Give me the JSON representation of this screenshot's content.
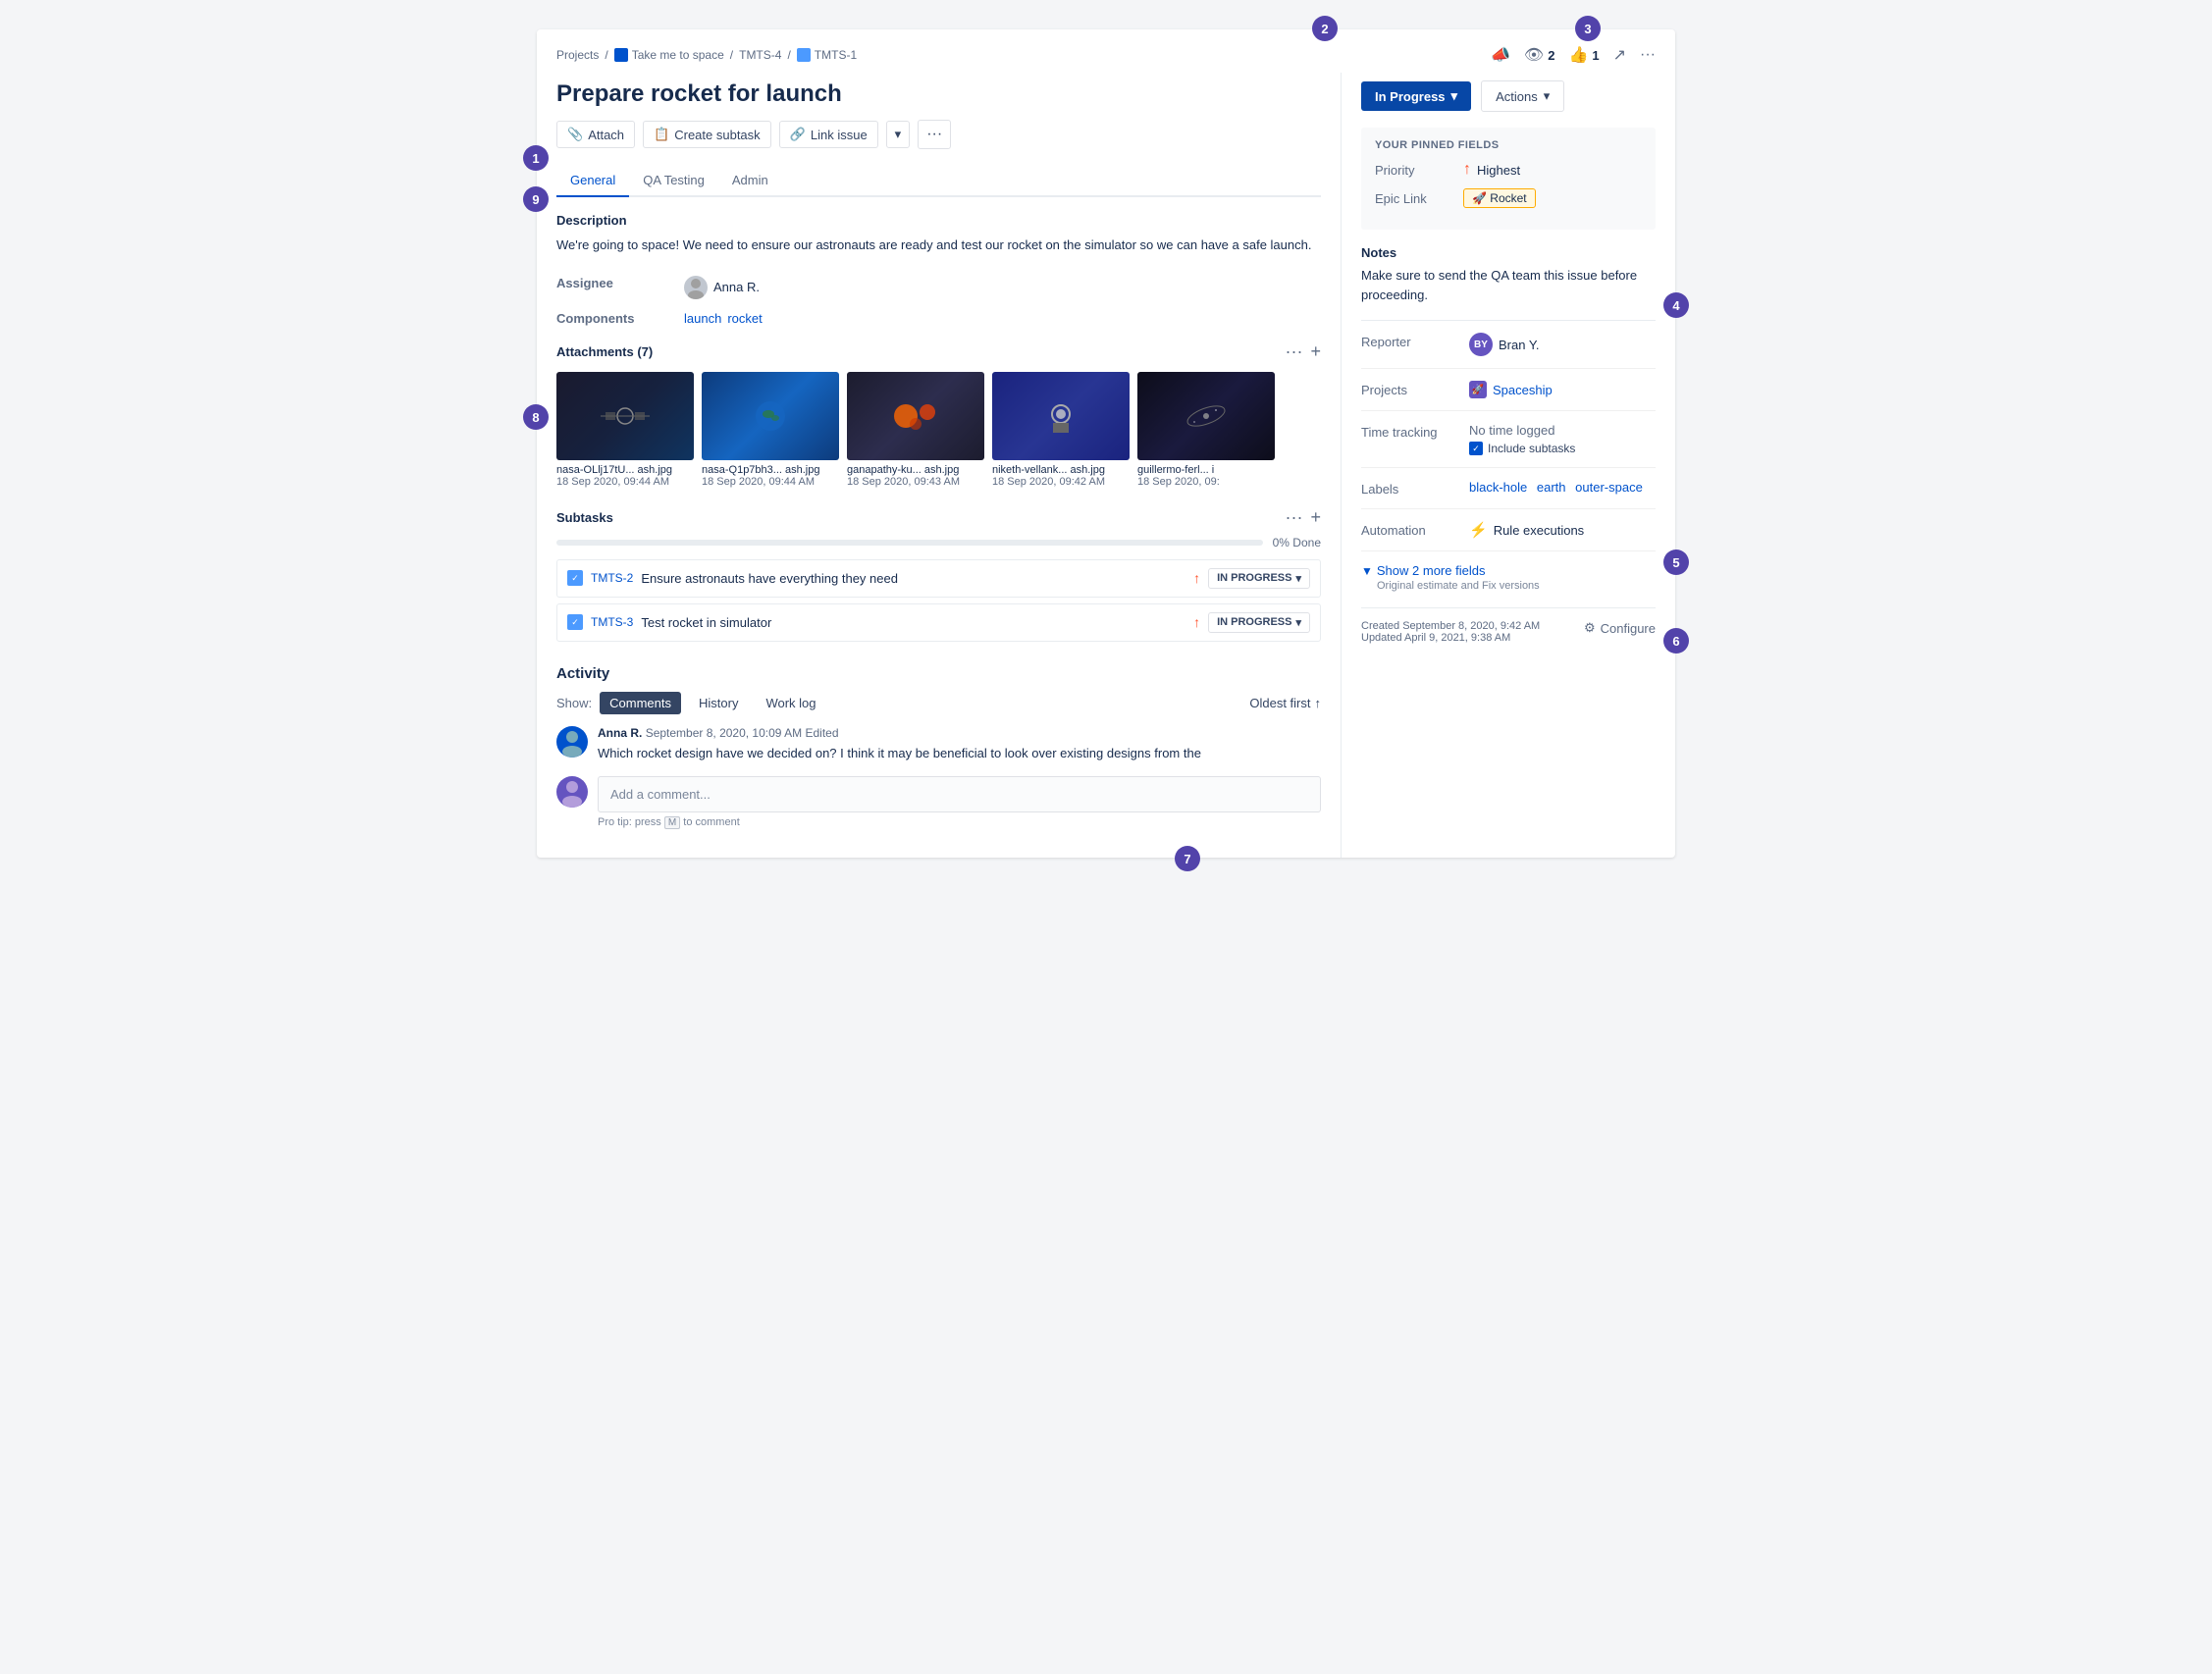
{
  "breadcrumb": {
    "projects": "Projects",
    "space": "Take me to space",
    "tmts4": "TMTS-4",
    "tmts1": "TMTS-1"
  },
  "issue": {
    "title": "Prepare rocket for launch"
  },
  "toolbar": {
    "attach": "Attach",
    "create_subtask": "Create subtask",
    "link_issue": "Link issue",
    "more": "···"
  },
  "tabs": [
    "General",
    "QA Testing",
    "Admin"
  ],
  "description": {
    "label": "Description",
    "text": "We're going to space! We need to ensure our astronauts are ready and test our rocket on the simulator so we can have a safe launch."
  },
  "fields": {
    "assignee_label": "Assignee",
    "assignee_value": "Anna R.",
    "components_label": "Components",
    "components": [
      "launch",
      "rocket"
    ]
  },
  "attachments": {
    "title": "Attachments (7)",
    "items": [
      {
        "filename": "nasa-OLlj17tU... ash.jpg",
        "date": "18 Sep 2020, 09:44 AM",
        "thumb": "space"
      },
      {
        "filename": "nasa-Q1p7bh3... ash.jpg",
        "date": "18 Sep 2020, 09:44 AM",
        "thumb": "earth"
      },
      {
        "filename": "ganapathy-ku... ash.jpg",
        "date": "18 Sep 2020, 09:43 AM",
        "thumb": "moon"
      },
      {
        "filename": "niketh-vellank... ash.jpg",
        "date": "18 Sep 2020, 09:42 AM",
        "thumb": "astro"
      },
      {
        "filename": "guillermo-ferl... i",
        "date": "18 Sep 2020, 09:",
        "thumb": "galaxy"
      }
    ]
  },
  "subtasks": {
    "title": "Subtasks",
    "progress_pct": "0% Done",
    "progress_value": 0,
    "items": [
      {
        "id": "TMTS-2",
        "text": "Ensure astronauts have everything they need",
        "status": "IN PROGRESS"
      },
      {
        "id": "TMTS-3",
        "text": "Test rocket in simulator",
        "status": "IN PROGRESS"
      }
    ]
  },
  "activity": {
    "title": "Activity",
    "show_label": "Show:",
    "tabs": [
      "Comments",
      "History",
      "Work log"
    ],
    "active_tab": "Comments",
    "sort": "Oldest first",
    "comments": [
      {
        "author": "Anna R.",
        "date": "September 8, 2020, 10:09 AM",
        "edited": "Edited",
        "text": "Which rocket design have we decided on? I think it may be beneficial to look over existing designs from the"
      }
    ],
    "add_placeholder": "Add a comment...",
    "tip": "Pro tip: press",
    "tip_key": "M",
    "tip_suffix": "to comment"
  },
  "right_panel": {
    "top_icons": {
      "announce": "📣",
      "watch_count": "2",
      "like_count": "1"
    },
    "status": "In Progress",
    "actions": "Actions",
    "pinned_label": "YOUR PINNED FIELDS",
    "priority_label": "Priority",
    "priority_value": "Highest",
    "epic_label": "Epic Link",
    "epic_value": "🚀 Rocket",
    "notes_label": "Notes",
    "notes_text": "Make sure to send the QA team this issue before proceeding.",
    "reporter_label": "Reporter",
    "reporter_value": "Bran Y.",
    "projects_label": "Projects",
    "projects_value": "Spaceship",
    "time_tracking_label": "Time tracking",
    "time_tracking_value": "No time logged",
    "include_subtasks": "Include subtasks",
    "labels_label": "Labels",
    "labels": [
      "black-hole",
      "earth",
      "outer-space"
    ],
    "automation_label": "Automation",
    "automation_value": "Rule executions",
    "show_more_link": "Show 2 more fields",
    "show_more_sub": "Original estimate and Fix versions",
    "created": "Created September 8, 2020, 9:42 AM",
    "updated": "Updated April 9, 2021, 9:38 AM",
    "configure": "Configure"
  },
  "callouts": [
    1,
    2,
    3,
    4,
    5,
    6,
    7,
    8,
    9
  ]
}
